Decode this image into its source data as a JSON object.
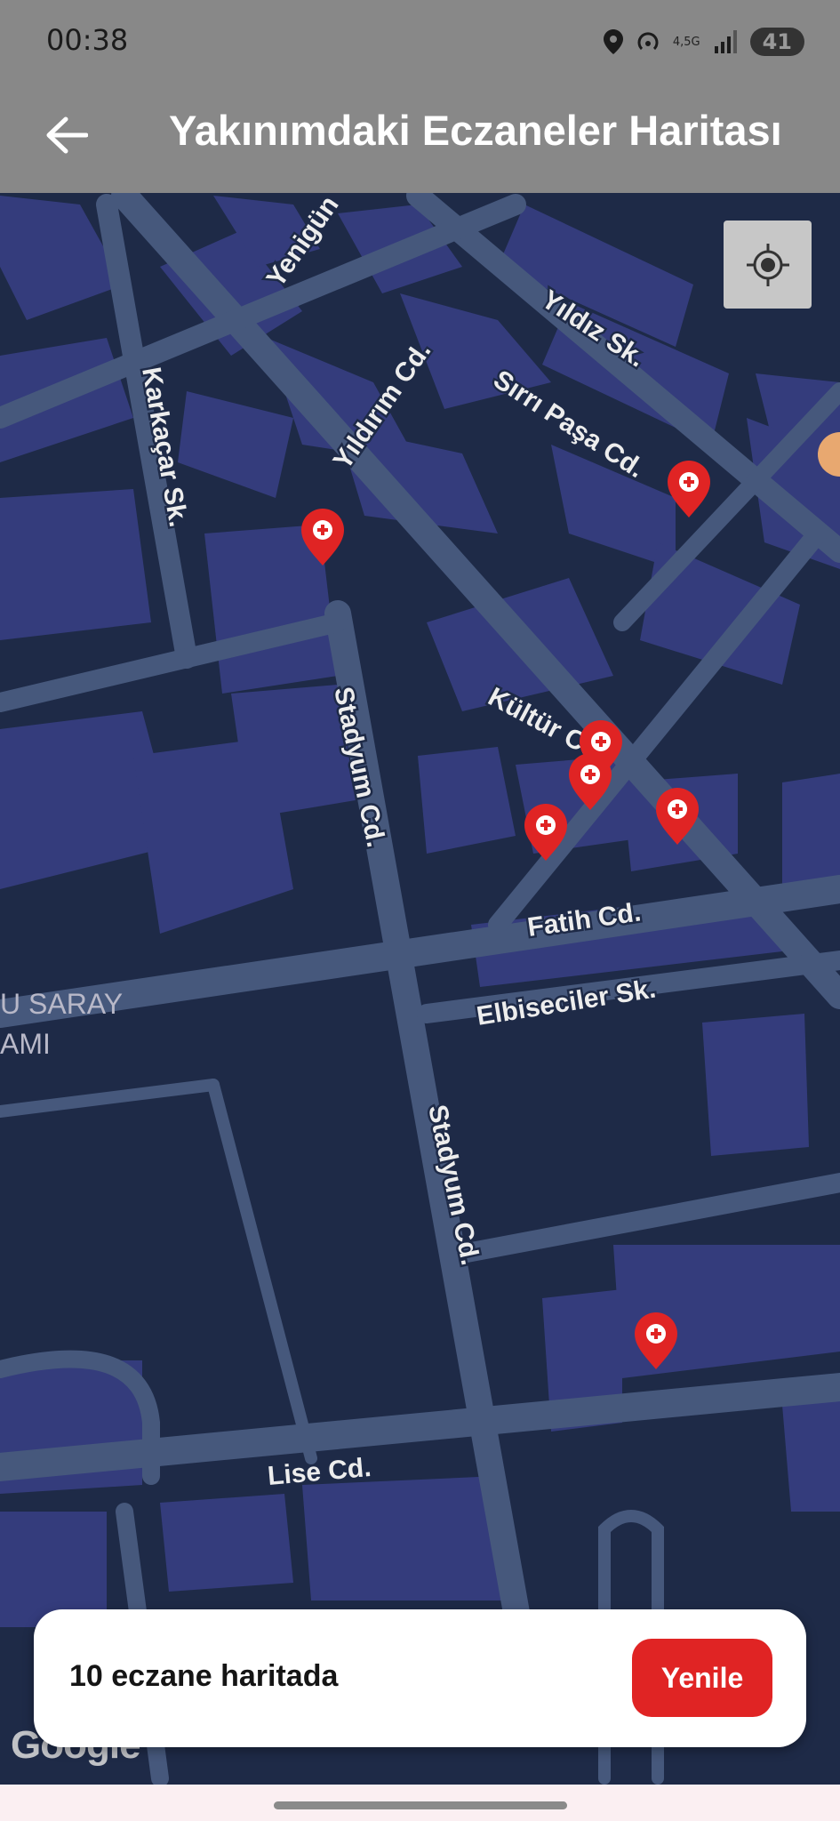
{
  "status_bar": {
    "time": "00:38",
    "network_type": "4,5G",
    "battery": "41",
    "icons": [
      "location-icon",
      "hotspot-icon",
      "signal-icon",
      "battery-icon"
    ]
  },
  "app_bar": {
    "title": "Yakınımdaki Eczaneler Haritası",
    "back_icon": "arrow-left-icon"
  },
  "map": {
    "streets": [
      "Yenigün",
      "Yıldız Sk.",
      "Sırrı Paşa Cd.",
      "Yıldırım Cd.",
      "Karkaçar Sk.",
      "Kültür Cd.",
      "Stadyum Cd.",
      "Stadyum Cd.",
      "Fatih Cd.",
      "Elbiseciler Sk.",
      "Lise Cd."
    ],
    "poi_lines": [
      "U SARAY",
      "AMI"
    ],
    "marker_count": 7,
    "marker_color": "#e02424",
    "locate_icon": "my-location-icon",
    "attribution": "Google"
  },
  "bottom_panel": {
    "count_text": "10 eczane haritada",
    "refresh_label": "Yenile",
    "refresh_color": "#e02424"
  }
}
